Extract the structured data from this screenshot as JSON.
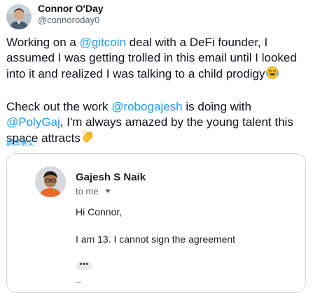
{
  "tweet": {
    "author_name": "Connor O'Day",
    "author_handle": "@connoroday0",
    "paragraph_1": [
      {
        "text": "Working on a "
      },
      {
        "text": "@gitcoin",
        "mention": true
      },
      {
        "text": " deal with a DeFi founder, I"
      },
      {
        "br": true
      },
      {
        "text": "assumed I was getting trolled in this email until I looked"
      },
      {
        "br": true
      },
      {
        "text": "into it and realized I was talking to a child prodigy"
      },
      {
        "emoji": "laughing-crying-emoji"
      }
    ],
    "paragraph_2": [
      {
        "text": "Check out the work "
      },
      {
        "text": "@robogajesh",
        "mention": true
      },
      {
        "text": " is doing with"
      },
      {
        "br": true
      },
      {
        "text": "@PolyGaj",
        "mention": true
      },
      {
        "text": ", I'm always amazed by the young talent this"
      },
      {
        "br": true
      },
      {
        "text": "space attracts"
      },
      {
        "emoji": "clapping-hands-emoji"
      }
    ],
    "translate_label": "翻译推文"
  },
  "email": {
    "sender_name": "Gajesh S Naik",
    "recipient_label": "to me",
    "greeting": "Hi Connor,",
    "body": "I am 13. I cannot sign the agreement",
    "more_label": "•••",
    "signature_dash": "--"
  },
  "colors": {
    "mention": "#1d9bf0",
    "text": "#0f1419",
    "secondary": "#536471",
    "card_border": "#cfd9de"
  }
}
